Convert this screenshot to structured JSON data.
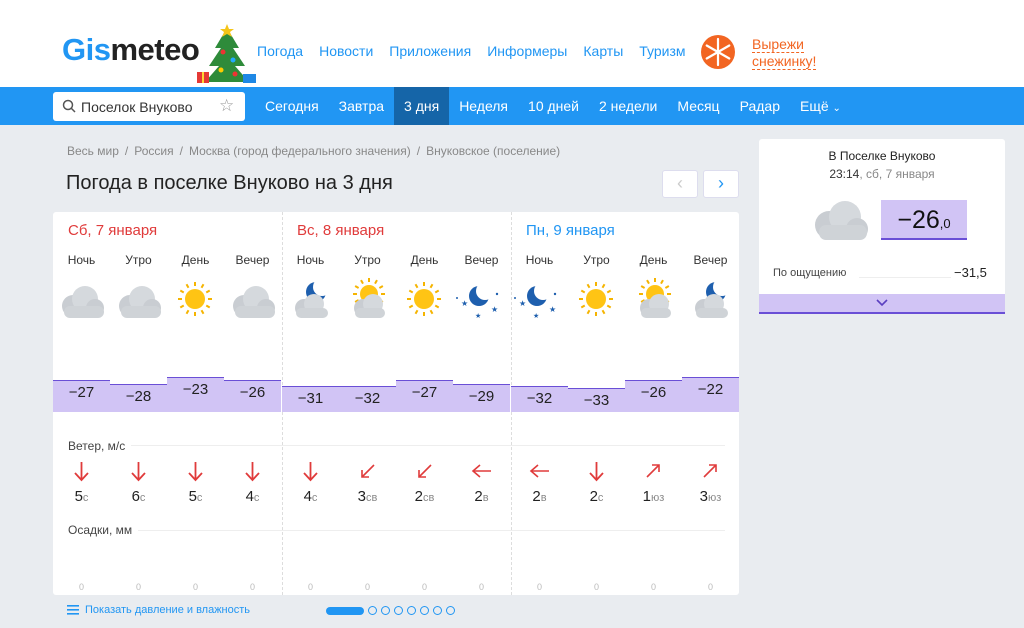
{
  "header": {
    "logo_part1": "Gis",
    "logo_part2": "meteo",
    "nav": [
      "Погода",
      "Новости",
      "Приложения",
      "Информеры",
      "Карты",
      "Туризм"
    ],
    "promo_line1": "Вырежи",
    "promo_line2": "снежинку!"
  },
  "navbar": {
    "search_value": "Поселок Внуково",
    "tabs": [
      "Сегодня",
      "Завтра",
      "3 дня",
      "Неделя",
      "10 дней",
      "2 недели",
      "Месяц",
      "Радар",
      "Ещё"
    ],
    "active_tab": "3 дня"
  },
  "breadcrumbs": [
    "Весь мир",
    "/",
    "Россия",
    "/",
    "Москва (город федерального значения)",
    "/",
    "Внуковское (поселение)"
  ],
  "page_title": "Погода в поселке Внуково на 3 дня",
  "forecast": {
    "slot_labels": [
      "Ночь",
      "Утро",
      "День",
      "Вечер"
    ],
    "wind_label": "Ветер, м/с",
    "precip_label": "Осадки, мм",
    "days": [
      {
        "title": "Сб, 7 января",
        "title_color": "#e03b3b",
        "temps": [
          "−27",
          "−28",
          "−23",
          "−26"
        ],
        "icons": [
          "cloud-icon",
          "cloud-icon",
          "sun-icon",
          "cloud-icon"
        ],
        "wind": [
          {
            "speed": "5",
            "dir": "с",
            "arrow": "arrow-down-icon"
          },
          {
            "speed": "6",
            "dir": "с",
            "arrow": "arrow-down-icon"
          },
          {
            "speed": "5",
            "dir": "с",
            "arrow": "arrow-down-icon"
          },
          {
            "speed": "4",
            "dir": "с",
            "arrow": "arrow-down-icon"
          }
        ],
        "precip": [
          "0",
          "0",
          "0",
          "0"
        ]
      },
      {
        "title": "Вс, 8 января",
        "title_color": "#e03b3b",
        "temps": [
          "−31",
          "−32",
          "−27",
          "−29"
        ],
        "icons": [
          "moon-cloud-icon",
          "sun-cloud-icon",
          "sun-icon",
          "moon-stars-icon"
        ],
        "wind": [
          {
            "speed": "4",
            "dir": "с",
            "arrow": "arrow-down-icon"
          },
          {
            "speed": "3",
            "dir": "св",
            "arrow": "arrow-down-left-icon"
          },
          {
            "speed": "2",
            "dir": "св",
            "arrow": "arrow-down-left-icon"
          },
          {
            "speed": "2",
            "dir": "в",
            "arrow": "arrow-left-icon"
          }
        ],
        "precip": [
          "0",
          "0",
          "0",
          "0"
        ]
      },
      {
        "title": "Пн, 9 января",
        "title_color": "#2196f3",
        "temps": [
          "−32",
          "−33",
          "−26",
          "−22"
        ],
        "icons": [
          "moon-stars-icon",
          "sun-icon",
          "sun-cloud-icon",
          "moon-cloud-icon"
        ],
        "wind": [
          {
            "speed": "2",
            "dir": "в",
            "arrow": "arrow-left-icon"
          },
          {
            "speed": "2",
            "dir": "с",
            "arrow": "arrow-down-icon"
          },
          {
            "speed": "1",
            "dir": "юз",
            "arrow": "arrow-up-right-icon"
          },
          {
            "speed": "3",
            "dir": "юз",
            "arrow": "arrow-up-right-icon"
          }
        ],
        "precip": [
          "0",
          "0",
          "0",
          "0"
        ]
      }
    ]
  },
  "show_more": "Показать давление и влажность",
  "current": {
    "place": "В Поселке Внуково",
    "time": "23:14",
    "date": ", сб, 7 января",
    "temp_main": "−26",
    "temp_decimal": ",0",
    "feels_label": "По ощущению",
    "feels_value": "−31,5"
  },
  "colors": {
    "accent": "#2196f3",
    "temp_fill": "#d1c4f5",
    "temp_line": "#6a4fd6",
    "promo": "#f26522"
  }
}
